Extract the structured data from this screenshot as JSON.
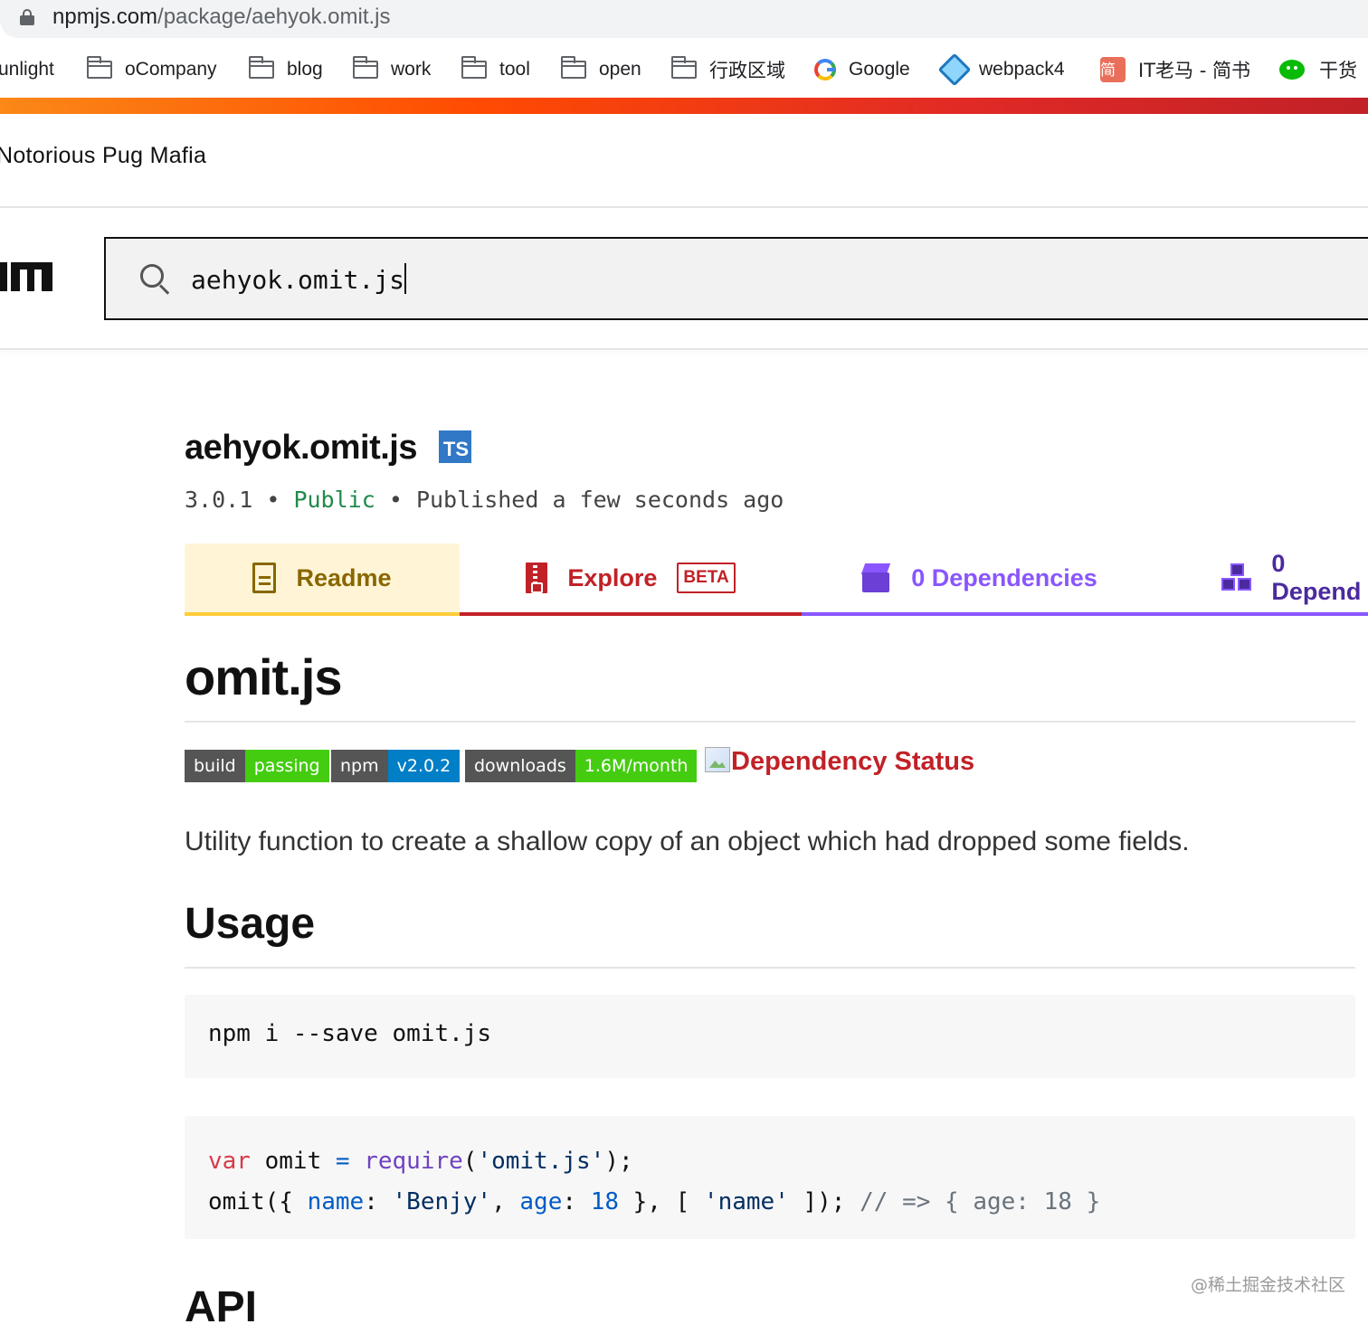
{
  "browser": {
    "url_host": "npmjs.com",
    "url_path": "/package/aehyok.omit.js",
    "bookmarks": [
      {
        "label": "unlight",
        "icon": "none"
      },
      {
        "label": "oCompany",
        "icon": "folder-icon"
      },
      {
        "label": "blog",
        "icon": "folder-icon"
      },
      {
        "label": "work",
        "icon": "folder-icon"
      },
      {
        "label": "tool",
        "icon": "folder-icon"
      },
      {
        "label": "open",
        "icon": "folder-icon"
      },
      {
        "label": "行政区域",
        "icon": "folder-icon"
      },
      {
        "label": "Google",
        "icon": "google-icon"
      },
      {
        "label": "webpack4",
        "icon": "webpack-icon"
      },
      {
        "label": "IT老马 - 简书",
        "icon": "jianshu-icon",
        "icon_text": "简"
      },
      {
        "label": "干货",
        "icon": "wechat-icon"
      }
    ]
  },
  "npm": {
    "tagline": "Notorious Pug Mafia",
    "search_value": "aehyok.omit.js",
    "brand_color": "#cb3837"
  },
  "package": {
    "name": "aehyok.omit.js",
    "ts_badge": "TS",
    "version": "3.0.1",
    "visibility": "Public",
    "published": "Published a few seconds ago",
    "separator": "•"
  },
  "tabs": [
    {
      "label": "Readme",
      "icon": "doc-icon",
      "active": true
    },
    {
      "label": "Explore",
      "icon": "zip-icon",
      "badge": "BETA"
    },
    {
      "label": "0 Dependencies",
      "icon": "box-icon"
    },
    {
      "label": "0 Depend",
      "icon": "boxes-icon"
    }
  ],
  "readme": {
    "title": "omit.js",
    "badges": [
      {
        "label": "build",
        "value": "passing",
        "color": "#4c1"
      },
      {
        "label": "npm",
        "value": "v2.0.2",
        "color": "#007ec6"
      },
      {
        "label": "downloads",
        "value": "1.6M/month",
        "color": "#4c1"
      }
    ],
    "dependency_status_alt": "Dependency Status",
    "description": "Utility function to create a shallow copy of an object which had dropped some fields.",
    "usage_heading": "Usage",
    "install_cmd": "npm i --save omit.js",
    "code": {
      "l1_var": "var",
      "l1_name": " omit ",
      "l1_eq": "=",
      "l1_require": " require",
      "l1_open": "(",
      "l1_str": "'omit.js'",
      "l1_close": ");",
      "l2_call": "omit({ ",
      "l2_name_key": "name",
      "l2_colon1": ": ",
      "l2_name_val": "'Benjy'",
      "l2_comma": ", ",
      "l2_age_key": "age",
      "l2_colon2": ": ",
      "l2_age_val": "18",
      "l2_mid": " }, [ ",
      "l2_arr_val": "'name'",
      "l2_end": " ]); ",
      "l2_comment": "// => { age: 18 }"
    },
    "api_heading": "API"
  },
  "watermark": "@稀土掘金技术社区"
}
